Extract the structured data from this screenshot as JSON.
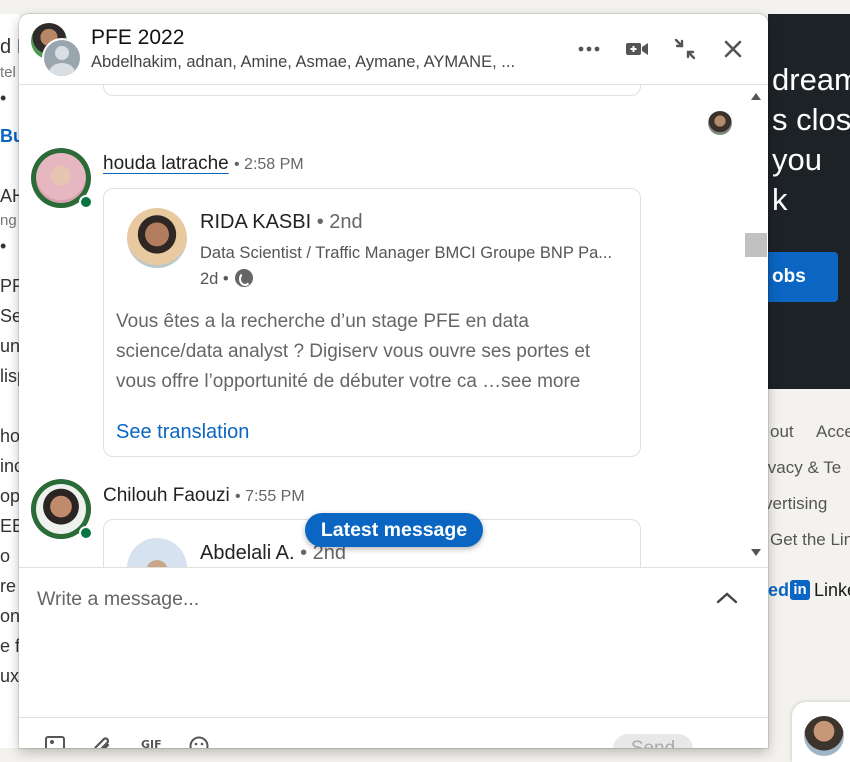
{
  "background": {
    "left_fragments": [
      "d I",
      "tel",
      "•",
      "Bu",
      "AH",
      "ng",
      "•",
      "PFE",
      "Se",
      "un",
      "lisp",
      "hol",
      "inc",
      "opp",
      "EE/",
      "o",
      "re",
      "on",
      "e f",
      "ux"
    ],
    "ad_lines": [
      "dream",
      "s close",
      "you",
      "k"
    ],
    "ad_button": "obs",
    "footer_links": [
      "out",
      "Acce",
      "ivacy & Te",
      "vertising",
      "Get the Lin"
    ],
    "brand_prefix": "ed",
    "brand_in": "in",
    "brand_suffix": "Linke"
  },
  "chat": {
    "title": "PFE 2022",
    "participants": "Abdelhakim, adnan, Amine, Asmae, Aymane, AYMANE, ...",
    "header_icons": [
      "more-icon",
      "video-call-icon",
      "minimize-icon",
      "close-icon"
    ],
    "messages": [
      {
        "sender": "houda latrache",
        "time": "• 2:58 PM",
        "shared_post": {
          "author": "RIDA KASBI",
          "degree": "• 2nd",
          "headline": "Data Scientist / Traffic Manager BMCI Groupe BNP Pa...",
          "age": "2d •",
          "text_lines": [
            "Vous êtes a la recherche d’un stage PFE en data",
            "science/data analyst ? Digiserv vous ouvre ses portes et",
            "vous offre l’opportunité de débuter votre ca"
          ],
          "see_more": "…see more",
          "see_translation": "See translation"
        }
      },
      {
        "sender": "Chilouh Faouzi",
        "time": "• 7:55 PM",
        "shared_post": {
          "author": "Abdelali A.",
          "degree": "• 2nd"
        }
      }
    ],
    "latest_message_label": "Latest message",
    "composer": {
      "placeholder": "Write a message..."
    },
    "send_label": "Send",
    "toolbar_icons": [
      "image-icon",
      "attachment-icon",
      "gif-icon",
      "emoji-icon"
    ]
  }
}
